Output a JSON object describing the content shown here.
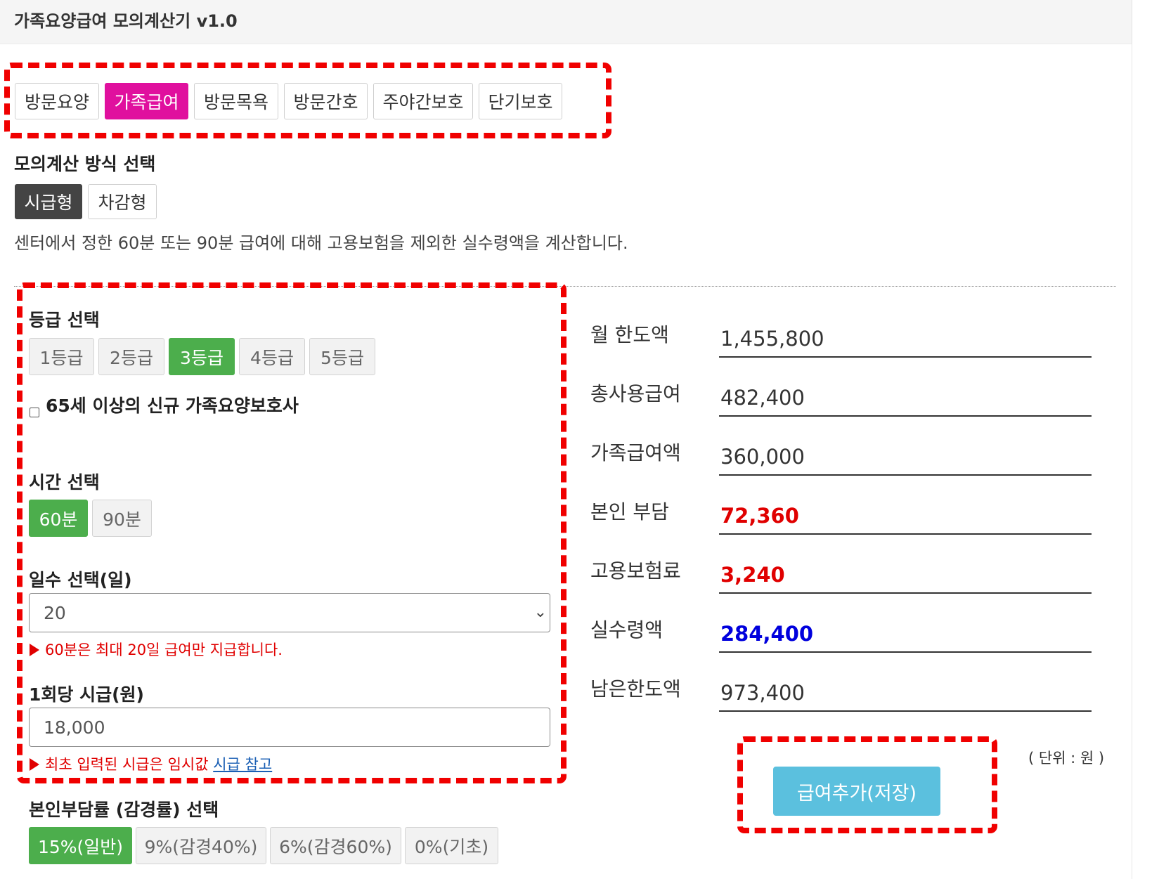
{
  "app": {
    "title": "가족요양급여 모의계산기 v1.0"
  },
  "service_tabs": [
    {
      "label": "방문요양",
      "active": false
    },
    {
      "label": "가족급여",
      "active": true
    },
    {
      "label": "방문목욕",
      "active": false
    },
    {
      "label": "방문간호",
      "active": false
    },
    {
      "label": "주야간보호",
      "active": false
    },
    {
      "label": "단기보호",
      "active": false
    }
  ],
  "method": {
    "heading": "모의계산 방식 선택",
    "options": [
      {
        "label": "시급형",
        "active": true
      },
      {
        "label": "차감형",
        "active": false
      }
    ],
    "description": "센터에서 정한 60분 또는 90분 급여에 대해 고용보험을 제외한 실수령액을 계산합니다."
  },
  "grade": {
    "heading": "등급 선택",
    "options": [
      {
        "label": "1등급",
        "active": false
      },
      {
        "label": "2등급",
        "active": false
      },
      {
        "label": "3등급",
        "active": true
      },
      {
        "label": "4등급",
        "active": false
      },
      {
        "label": "5등급",
        "active": false
      }
    ],
    "senior_checkbox": {
      "label": "65세 이상의 신규 가족요양보호사",
      "checked": false
    }
  },
  "time": {
    "heading": "시간 선택",
    "options": [
      {
        "label": "60분",
        "active": true
      },
      {
        "label": "90분",
        "active": false
      }
    ]
  },
  "days": {
    "heading": "일수 선택(일)",
    "selected": "20",
    "note": "60분은 최대 20일 급여만 지급합니다."
  },
  "wage": {
    "heading": "1회당 시급(원)",
    "value": "18,000",
    "note": "최초 입력된 시급은 임시값",
    "link": "시급 참고"
  },
  "burden": {
    "heading": "본인부담률 (감경률) 선택",
    "options": [
      {
        "label": "15%(일반)",
        "active": true
      },
      {
        "label": "9%(감경40%)",
        "active": false
      },
      {
        "label": "6%(감경60%)",
        "active": false
      },
      {
        "label": "0%(기초)",
        "active": false
      }
    ]
  },
  "results": [
    {
      "label": "월 한도액",
      "value": "1,455,800",
      "style": "normal"
    },
    {
      "label": "총사용급여",
      "value": "482,400",
      "style": "normal"
    },
    {
      "label": "가족급여액",
      "value": "360,000",
      "style": "normal"
    },
    {
      "label": "본인 부담",
      "value": "72,360",
      "style": "red"
    },
    {
      "label": "고용보험료",
      "value": "3,240",
      "style": "red"
    },
    {
      "label": "실수령액",
      "value": "284,400",
      "style": "blue"
    },
    {
      "label": "남은한도액",
      "value": "973,400",
      "style": "normal"
    }
  ],
  "unit_note": "( 단위 : 원 )",
  "save_button": "급여추가(저장)",
  "colors": {
    "tab_active": "#e0109e",
    "option_active": "#4cae4c",
    "method_active": "#444444",
    "save": "#5bc0de",
    "annotation": "#f00000",
    "negative": "#e00000",
    "net": "#0000dd"
  }
}
